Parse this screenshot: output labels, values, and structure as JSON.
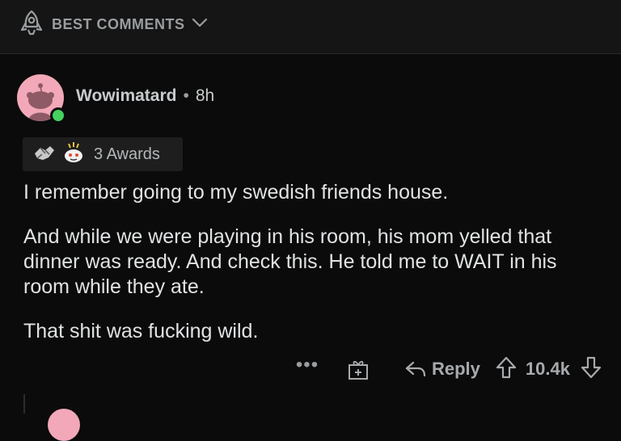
{
  "sort": {
    "label": "BEST COMMENTS"
  },
  "comment": {
    "username": "Wowimatard",
    "separator": "•",
    "age": "8h",
    "awards_label": "3 Awards",
    "paragraphs": [
      "I remember going to my swedish friends house.",
      "And while we were playing in his room, his mom yelled that dinner was ready. And check this. He told me to WAIT in his room while they ate.",
      "That shit was fucking wild."
    ],
    "actions": {
      "more": "•••",
      "reply_label": "Reply",
      "vote_count": "10.4k"
    }
  },
  "colors": {
    "online": "#46d160",
    "avatar_bg": "#f2a8b8"
  },
  "icons": [
    "rocket-icon",
    "chevron-down-icon",
    "snoo-avatar",
    "handshake-award-icon",
    "snoo-award-icon",
    "gift-icon",
    "reply-arrow-icon",
    "upvote-icon",
    "downvote-icon"
  ]
}
